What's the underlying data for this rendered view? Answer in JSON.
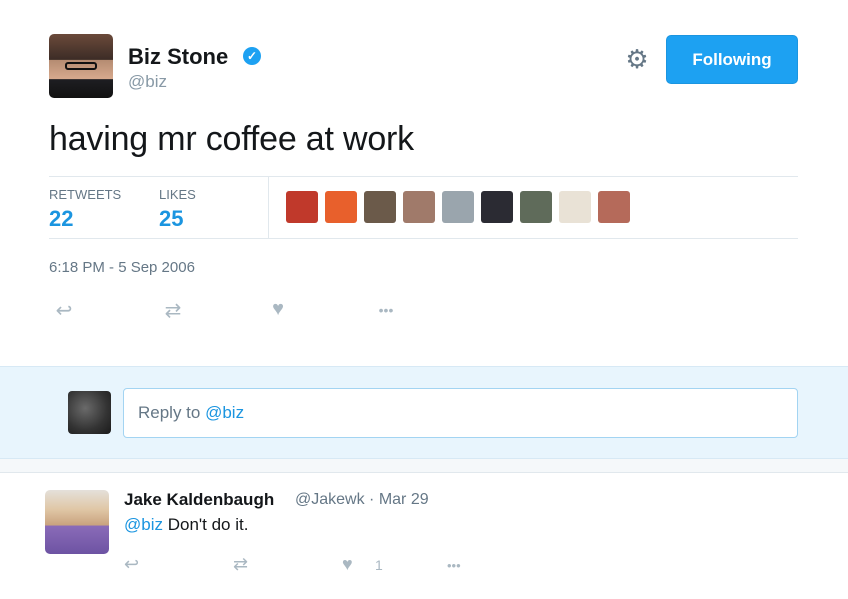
{
  "tweet": {
    "author_name": "Biz Stone",
    "verified_icon": "verified-badge-icon",
    "author_handle": "@biz",
    "follow_label": "Following",
    "settings_icon": "gear-icon",
    "text": "having mr coffee at work",
    "stats": {
      "retweets_label": "RETWEETS",
      "retweets_value": "22",
      "likes_label": "LIKES",
      "likes_value": "25"
    },
    "timestamp": "6:18 PM - 5 Sep 2006",
    "actions": {
      "reply_icon": "↩",
      "retweet_icon": "⇄",
      "like_icon": "♥",
      "more_icon": "•••"
    }
  },
  "reply_box": {
    "prefix": "Reply to ",
    "mention": "@biz"
  },
  "reply_tweet": {
    "author_name": "Jake Kaldenbaugh",
    "meta": "@Jakewk · Mar 29",
    "mention": "@biz",
    "text": " Don't do it.",
    "like_count": "1",
    "actions": {
      "reply_icon": "↩",
      "retweet_icon": "⇄",
      "like_icon": "♥",
      "more_icon": "•••"
    }
  },
  "colors": {
    "accent": "#1da1f2",
    "link": "#1b95e0",
    "muted": "#657786",
    "reply_bg": "#e8f5fd"
  },
  "liker_avatars": [
    {
      "color": "#c0392b"
    },
    {
      "color": "#e8602c"
    },
    {
      "color": "#6b5a4a"
    },
    {
      "color": "#a07a6a"
    },
    {
      "color": "#9aa5ad"
    },
    {
      "color": "#2b2b33"
    },
    {
      "color": "#5f6b5a"
    },
    {
      "color": "#e9e2d6"
    },
    {
      "color": "#b56a5a"
    }
  ]
}
